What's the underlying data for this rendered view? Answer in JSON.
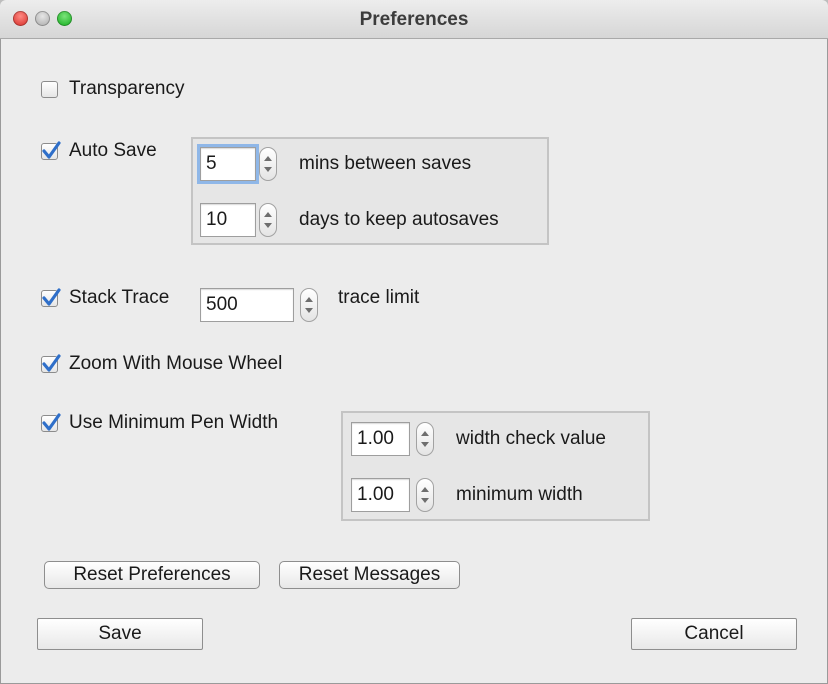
{
  "window": {
    "title": "Preferences"
  },
  "transparency": {
    "label": "Transparency",
    "checked": false
  },
  "auto_save": {
    "label": "Auto Save",
    "checked": true,
    "mins_value": "5",
    "mins_label": "mins between saves",
    "days_value": "10",
    "days_label": "days to keep autosaves"
  },
  "stack_trace": {
    "label": "Stack Trace",
    "checked": true,
    "value": "500",
    "suffix": "trace limit"
  },
  "zoom_wheel": {
    "label": "Zoom With Mouse Wheel",
    "checked": true
  },
  "min_pen": {
    "label": "Use Minimum Pen Width",
    "checked": true,
    "check_value": "1.00",
    "check_label": "width check value",
    "min_value": "1.00",
    "min_label": "minimum width"
  },
  "buttons": {
    "reset_prefs": "Reset Preferences",
    "reset_msgs": "Reset Messages",
    "save": "Save",
    "cancel": "Cancel"
  },
  "colors": {
    "check": "#2f6fc9",
    "focus": "#8fb7e8"
  }
}
